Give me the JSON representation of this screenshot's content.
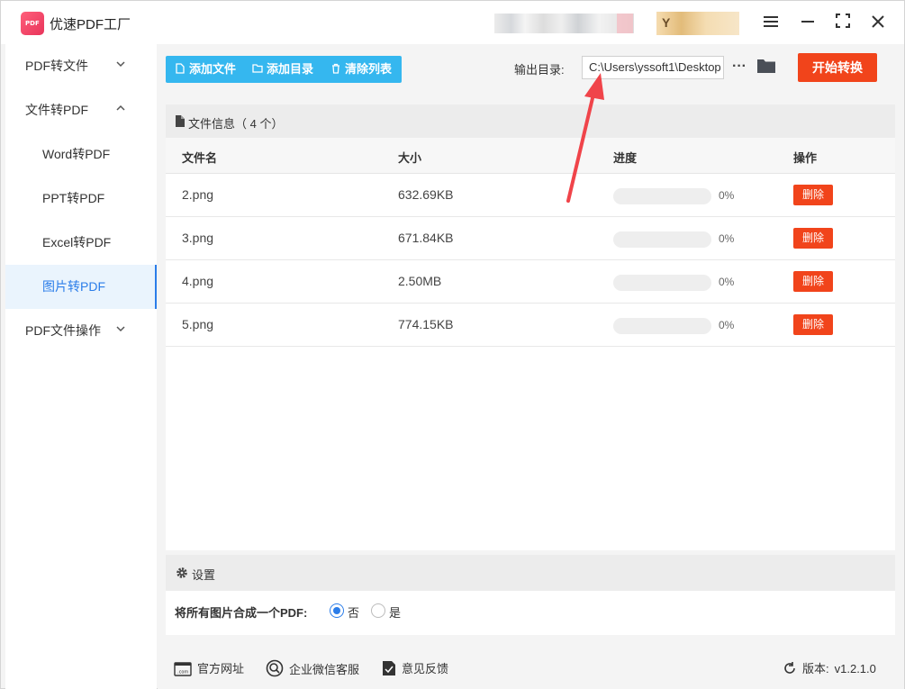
{
  "app": {
    "title": "优速PDF工厂"
  },
  "sidebar": {
    "items": [
      {
        "label": "PDF转文件",
        "chevron": "chevron-down"
      },
      {
        "label": "文件转PDF",
        "chevron": "chevron-up"
      },
      {
        "label": "Word转PDF"
      },
      {
        "label": "PPT转PDF"
      },
      {
        "label": "Excel转PDF"
      },
      {
        "label": "图片转PDF",
        "active": true
      },
      {
        "label": "PDF文件操作",
        "chevron": "chevron-down"
      }
    ]
  },
  "toolbar": {
    "add_file": "添加文件",
    "add_dir": "添加目录",
    "clear_list": "清除列表",
    "output_label": "输出目录:",
    "output_path": "C:\\Users\\yssoft1\\Desktop",
    "more": "···",
    "start": "开始转换"
  },
  "file_panel": {
    "title": "文件信息（ 4 个）",
    "columns": {
      "name": "文件名",
      "size": "大小",
      "progress": "进度",
      "action": "操作"
    },
    "rows": [
      {
        "name": "2.png",
        "size": "632.69KB",
        "progress": 0,
        "progress_text": "0%",
        "action": "删除"
      },
      {
        "name": "3.png",
        "size": "671.84KB",
        "progress": 0,
        "progress_text": "0%",
        "action": "删除"
      },
      {
        "name": "4.png",
        "size": "2.50MB",
        "progress": 0,
        "progress_text": "0%",
        "action": "删除"
      },
      {
        "name": "5.png",
        "size": "774.15KB",
        "progress": 0,
        "progress_text": "0%",
        "action": "删除"
      }
    ]
  },
  "settings": {
    "title": "设置",
    "merge_label": "将所有图片合成一个PDF:",
    "options": [
      {
        "label": "否",
        "selected": true
      },
      {
        "label": "是",
        "selected": false
      }
    ]
  },
  "footer": {
    "website": "官方网址",
    "wechat": "企业微信客服",
    "feedback": "意见反馈",
    "version_label": "版本:",
    "version": "v1.2.1.0"
  },
  "colors": {
    "accent_blue": "#35b7ef",
    "action_red": "#f1441b",
    "active_blue": "#2b7de9",
    "annotation_arrow": "#f0444a"
  }
}
